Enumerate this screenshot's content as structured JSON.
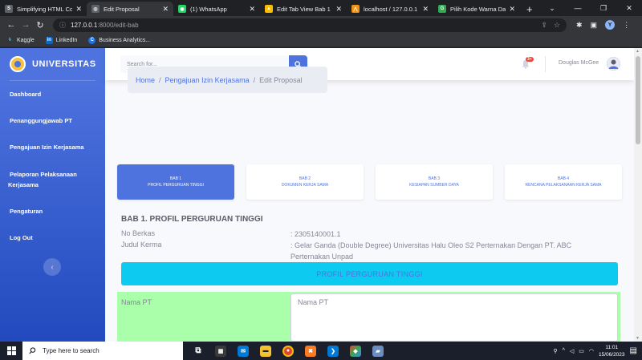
{
  "browser": {
    "tabs": [
      {
        "title": "Simplifying HTML Co",
        "favicon_color": "#5f6368",
        "favicon_glyph": "S"
      },
      {
        "title": "Edit Proposal",
        "favicon_color": "#5f6368",
        "favicon_glyph": "◎",
        "active": true
      },
      {
        "title": "(1) WhatsApp",
        "favicon_color": "#25d366",
        "favicon_glyph": "◉"
      },
      {
        "title": "Edit Tab View Bab 1 -",
        "favicon_color": "#fbbc04",
        "favicon_glyph": "▲"
      },
      {
        "title": "localhost / 127.0.0.1 /",
        "favicon_color": "#f29111",
        "favicon_glyph": "⋀"
      },
      {
        "title": "Pilih Kode Warna Dari",
        "favicon_color": "#34a853",
        "favicon_glyph": "G"
      }
    ],
    "url_host": "127.0.0.1",
    "url_path": ":8000/edit-bab",
    "profile_initial": "Y",
    "bookmarks": [
      {
        "label": "Kaggle",
        "icon_glyph": "k",
        "icon_color": "#20beff"
      },
      {
        "label": "LinkedIn",
        "icon_glyph": "in",
        "icon_color": "#0a66c2"
      },
      {
        "label": "Business Analytics...",
        "icon_glyph": "C",
        "icon_color": "#1a73e8"
      }
    ]
  },
  "sidebar": {
    "brand": "UNIVERSITAS",
    "items": [
      {
        "label": "Dashboard"
      },
      {
        "label": "Penanggungjawab PT"
      },
      {
        "label": "Pengajuan Izin Kerjasama"
      },
      {
        "label_line1": "Pelaporan Pelaksanaan",
        "label_line2": "Kerjasama"
      },
      {
        "label": "Pengaturan"
      },
      {
        "label": "Log Out"
      }
    ],
    "toggle_glyph": "‹"
  },
  "topbar": {
    "search_placeholder": "Search for...",
    "alerts_count": "3+",
    "user_name": "Douglas McGee"
  },
  "breadcrumb": {
    "home": "Home",
    "parent": "Pengajuan Izin Kerjasama",
    "current": "Edit Proposal",
    "separator": "/"
  },
  "steps": [
    {
      "number": "BAB 1",
      "label": "PROFIL PERGURUAN TINGGI",
      "active": true
    },
    {
      "number": "BAB 2",
      "label": "DOKUMEN KERJA SAMA"
    },
    {
      "number": "BAB 3",
      "label": "KESIAPAN SUMBER DAYA"
    },
    {
      "number": "BAB 4",
      "label": "RENCANA PELAKSANAAN KERJA SAMA"
    }
  ],
  "section": {
    "title": "BAB 1. PROFIL PERGURUAN TINGGI",
    "no_berkas_label": "No Berkas",
    "no_berkas_value": ": 2305140001.1",
    "judul_label": "Judul Kerma",
    "judul_value": ": Gelar Ganda (Double Degree) Universitas Halu Oleo S2 Perternakan Dengan PT. ABC Perternakan Unpad",
    "banner": "PROFIL PERGURUAN TINGGI",
    "field_label": "Nama PT",
    "field_placeholder": "Nama PT"
  },
  "taskbar": {
    "search_placeholder": "Type here to search",
    "time": "11:01",
    "date": "15/06/2023"
  },
  "colors": {
    "primary": "#4e73df",
    "info": "#0dcaf0",
    "form_highlight": "#aaffaa"
  }
}
